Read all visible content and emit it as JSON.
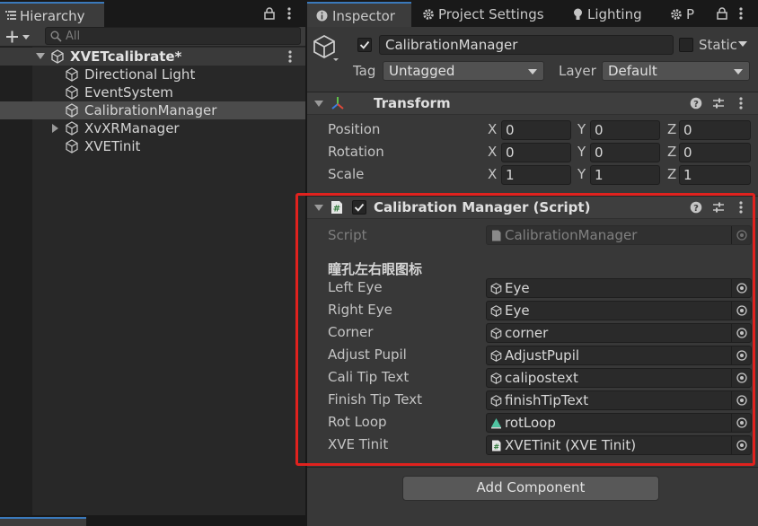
{
  "hierarchy": {
    "tab_label": "Hierarchy",
    "search_placeholder": "All",
    "scene_name": "XVETcalibrate*",
    "items": [
      {
        "label": "Directional Light"
      },
      {
        "label": "EventSystem"
      },
      {
        "label": "CalibrationManager",
        "selected": true
      },
      {
        "label": "XvXRManager",
        "has_children": true
      },
      {
        "label": "XVETinit"
      }
    ]
  },
  "inspector": {
    "tabs": [
      {
        "label": "Inspector"
      },
      {
        "label": "Project Settings"
      },
      {
        "label": "Lighting"
      },
      {
        "label": "P"
      }
    ],
    "object_name": "CalibrationManager",
    "static_label": "Static",
    "tag_label": "Tag",
    "tag_value": "Untagged",
    "layer_label": "Layer",
    "layer_value": "Default",
    "transform": {
      "title": "Transform",
      "rows": [
        {
          "label": "Position",
          "x": "0",
          "y": "0",
          "z": "0"
        },
        {
          "label": "Rotation",
          "x": "0",
          "y": "0",
          "z": "0"
        },
        {
          "label": "Scale",
          "x": "1",
          "y": "1",
          "z": "1"
        }
      ],
      "axis_x": "X",
      "axis_y": "Y",
      "axis_z": "Z"
    },
    "script_component": {
      "title": "Calibration Manager (Script)",
      "script_label": "Script",
      "script_value": "CalibrationManager",
      "section_header": "瞳孔左右眼图标",
      "fields": [
        {
          "label": "Left Eye",
          "value": "Eye",
          "icon": "cube-icon"
        },
        {
          "label": "Right Eye",
          "value": "Eye",
          "icon": "cube-icon"
        },
        {
          "label": "Corner",
          "value": "corner",
          "icon": "cube-icon"
        },
        {
          "label": "Adjust Pupil",
          "value": "AdjustPupil",
          "icon": "cube-icon"
        },
        {
          "label": "Cali Tip Text",
          "value": "calipostext",
          "icon": "cube-icon"
        },
        {
          "label": "Finish Tip Text",
          "value": "finishTipText",
          "icon": "cube-icon"
        },
        {
          "label": "Rot Loop",
          "value": "rotLoop",
          "icon": "animation-icon"
        },
        {
          "label": "XVE Tinit",
          "value": "XVETinit (XVE Tinit)",
          "icon": "script-icon"
        }
      ]
    },
    "add_component_label": "Add Component"
  },
  "colors": {
    "accent_tab": "#3a79bb",
    "highlight_box": "#e0221e",
    "panel_bg": "#383838"
  }
}
